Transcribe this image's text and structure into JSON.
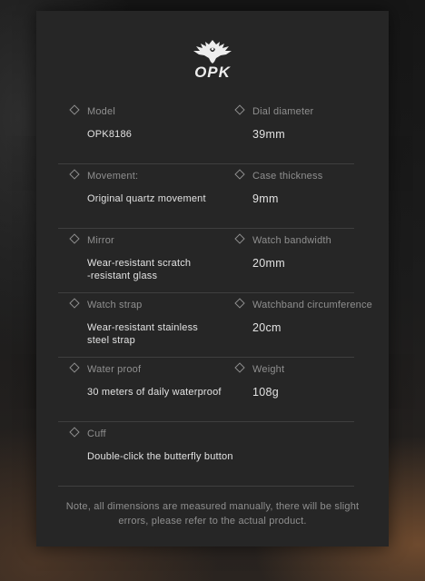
{
  "brand": {
    "logo_text": "OPK",
    "logo_icon": "eagle-emblem-icon"
  },
  "specs": [
    {
      "left": {
        "label": "Model",
        "value": "OPK8186"
      },
      "right": {
        "label": "Dial diameter",
        "value": "39mm"
      }
    },
    {
      "left": {
        "label": "Movement:",
        "value": "Original quartz movement"
      },
      "right": {
        "label": "Case thickness",
        "value": "9mm"
      }
    },
    {
      "left": {
        "label": "Mirror",
        "value_line1": "Wear-resistant scratch",
        "value_line2": "-resistant glass"
      },
      "right": {
        "label": "Watch bandwidth",
        "value": "20mm"
      }
    },
    {
      "left": {
        "label": "Watch strap",
        "value_line1": "Wear-resistant stainless",
        "value_line2": "steel strap"
      },
      "right": {
        "label": "Watchband circumference",
        "value": "20cm"
      }
    },
    {
      "left": {
        "label": "Water proof",
        "value": "30 meters of daily waterproof"
      },
      "right": {
        "label": "Weight",
        "value": "108g"
      }
    },
    {
      "left": {
        "label": "Cuff",
        "value": "Double-click the butterfly button"
      }
    }
  ],
  "note": {
    "line1": "Note, all dimensions are measured manually, there will be slight",
    "line2": "errors, please refer to the actual product."
  },
  "colors": {
    "card_background": "#262626",
    "label_text": "#8f8f8f",
    "value_text": "#e2e2e2",
    "divider": "#3f3f3f"
  }
}
